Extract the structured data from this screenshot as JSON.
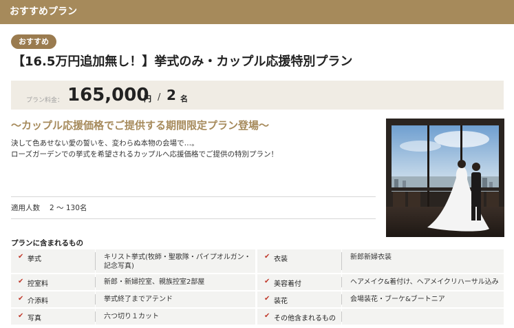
{
  "header": {
    "title": "おすすめプラン"
  },
  "plan": {
    "badge": "おすすめ",
    "title": "【16.5万円追加無し！】挙式のみ・カップル応援特別プラン",
    "price_label": "プラン料金：",
    "price": "165,000",
    "price_unit": "円",
    "slash": "/",
    "people": "2",
    "people_unit": "名",
    "tagline": "～カップル応援価格でご提供する期間限定プラン登場～",
    "description": [
      "決して色あせない愛の誓いを、変わらぬ本物の会場で…。",
      "ローズガーデンでの挙式を希望されるカップルへ応援価格でご提供の特別プラン！"
    ],
    "capacity_label": "適用人数",
    "capacity_value": "2 ～ 130名"
  },
  "includes": {
    "heading": "プランに含まれるもの",
    "rows": [
      {
        "k1": "挙式",
        "v1a": "キリスト挙式(牧師・聖歌隊・パイプオルガン・",
        "v1b": "記念写真)",
        "k2": "衣装",
        "v2": "新郎新婦衣装"
      },
      {
        "k1": "控室料",
        "v1a": "新郎・新婦控室、親族控室2部屋",
        "v1b": "",
        "k2": "美容着付",
        "v2": "ヘアメイク&着付け、ヘアメイクリハーサル込み"
      },
      {
        "k1": "介添料",
        "v1a": "挙式終了までアテンド",
        "v1b": "",
        "k2": "装花",
        "v2": "会場装花・ブーケ&ブートニア"
      },
      {
        "k1": "写真",
        "v1a": "六つ切り１カット",
        "v1b": "",
        "k2": "その他含まれるもの",
        "v2": ""
      }
    ]
  },
  "colors": {
    "accent": "#a68a5b",
    "badge": "#9a7b4f",
    "price_bg": "#f0ece4",
    "check": "#c0392b"
  },
  "icons": {
    "check": "check-icon"
  }
}
